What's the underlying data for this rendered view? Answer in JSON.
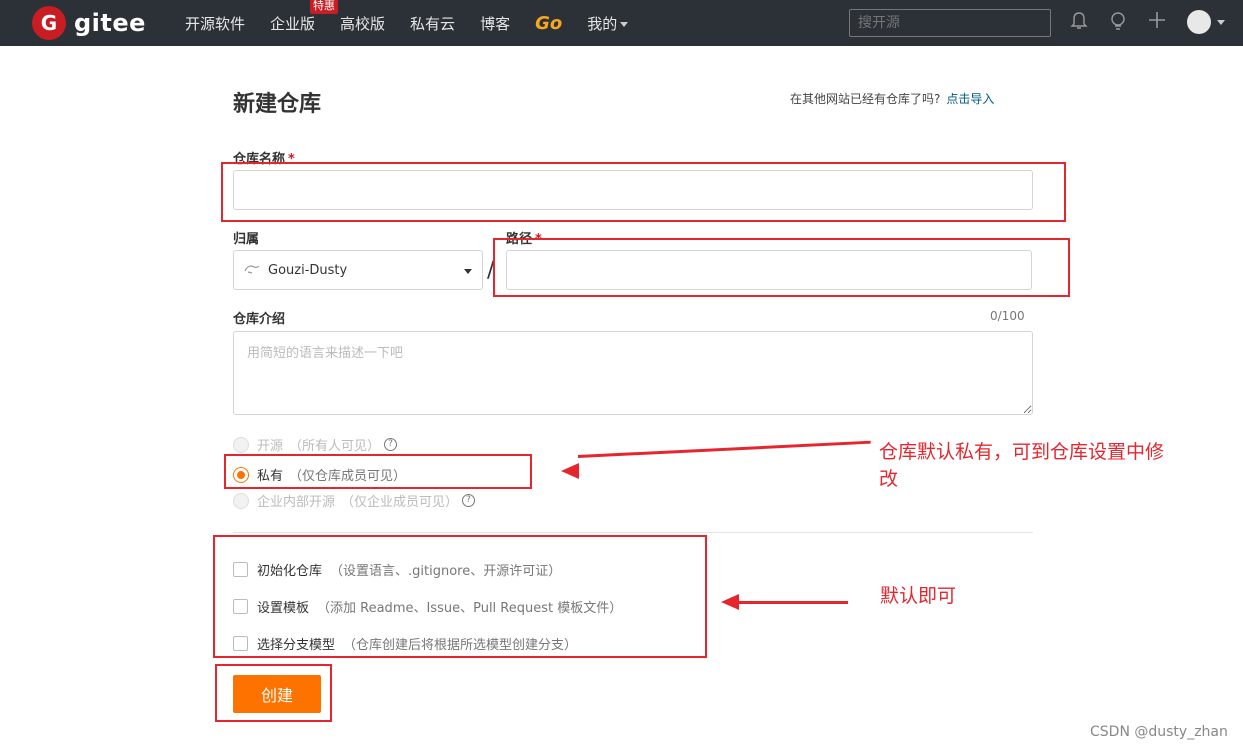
{
  "nav": {
    "logo_letter": "G",
    "logo_text": "gitee",
    "items": [
      {
        "label": "开源软件"
      },
      {
        "label": "企业版",
        "badge": "特惠"
      },
      {
        "label": "高校版"
      },
      {
        "label": "私有云"
      },
      {
        "label": "博客"
      },
      {
        "label": "Go"
      },
      {
        "label": "我的"
      }
    ],
    "search_placeholder": "搜开源",
    "icons": [
      "bell-icon",
      "lightbulb-icon",
      "plus-icon",
      "avatar"
    ]
  },
  "page": {
    "title": "新建仓库",
    "import_hint": "在其他网站已经有仓库了吗?",
    "import_link": "点击导入"
  },
  "form": {
    "name_label": "仓库名称",
    "required_mark": "*",
    "owner_label": "归属",
    "owner_value": "Gouzi-Dusty",
    "path_label": "路径",
    "path_separator": "/",
    "desc_label": "仓库介绍",
    "desc_counter": "0/100",
    "desc_placeholder": "用简短的语言来描述一下吧",
    "visibility": [
      {
        "label": "开源",
        "sub": "（所有人可见）",
        "help": "?",
        "checked": false,
        "disabled": true
      },
      {
        "label": "私有",
        "sub": "（仅仓库成员可见）",
        "checked": true,
        "disabled": false
      },
      {
        "label": "企业内部开源",
        "sub": "（仅企业成员可见）",
        "help": "?",
        "checked": false,
        "disabled": true
      }
    ],
    "options": [
      {
        "label": "初始化仓库",
        "sub": "（设置语言、.gitignore、开源许可证）",
        "checked": false
      },
      {
        "label": "设置模板",
        "sub": "（添加 Readme、Issue、Pull Request 模板文件）",
        "checked": false
      },
      {
        "label": "选择分支模型",
        "sub": "（仓库创建后将根据所选模型创建分支）",
        "checked": false
      }
    ],
    "submit_label": "创建"
  },
  "annotations": {
    "private_note_line1": "仓库默认私有，可到仓库设置中修",
    "private_note_line2": "改",
    "default_note": "默认即可",
    "color": "#e4272f"
  },
  "watermark": "CSDN @dusty_zhan",
  "colors": {
    "nav_bg": "#2b3137",
    "brand_red": "#c71d23",
    "accent_orange": "#fe7300",
    "go_gold": "#f5a623"
  }
}
